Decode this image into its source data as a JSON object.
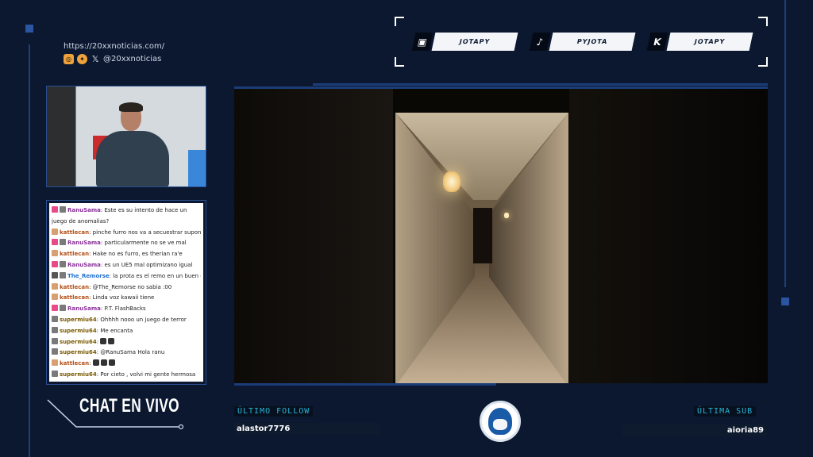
{
  "social": {
    "url": "https://20xxnoticias.com/",
    "handle": "@20xxnoticias",
    "icons": [
      "instagram-icon",
      "bluesky-icon",
      "x-icon"
    ]
  },
  "platforms": [
    {
      "icon": "twitch-icon",
      "label": "JOTAPY"
    },
    {
      "icon": "tiktok-icon",
      "label": "PYJOTA"
    },
    {
      "icon": "kick-icon",
      "label": "JOTAPY"
    }
  ],
  "chat": {
    "title": "CHAT EN VIVO",
    "messages": [
      {
        "user": "RanuSama",
        "text": "Este es su intento de hace un juego de anomalias?"
      },
      {
        "user": "kattlecan",
        "text": "pinche furro nos va a secuestrar supongo"
      },
      {
        "user": "RanuSama",
        "text": "particularmente no se ve mal"
      },
      {
        "user": "kattlecan",
        "text": "Hake no es furro, es therian ra'e"
      },
      {
        "user": "RanuSama",
        "text": "es un UE5 mal optimizano igual"
      },
      {
        "user": "The_Remorse",
        "text": "la prota es el remo en un buen dia"
      },
      {
        "user": "kattlecan",
        "text": "@The_Remorse no sabia :00"
      },
      {
        "user": "kattlecan",
        "text": "Linda voz kawaii tiene"
      },
      {
        "user": "RanuSama",
        "text": "P.T. FlashBacks"
      },
      {
        "user": "supermiu64",
        "text": "Ohhhh nooo un juego de terror"
      },
      {
        "user": "supermiu64",
        "text": "Me encanta"
      },
      {
        "user": "supermiu64",
        "text": ""
      },
      {
        "user": "supermiu64",
        "text": "@RanuSama Hola ranu"
      },
      {
        "user": "kattlecan",
        "text": ""
      },
      {
        "user": "supermiu64",
        "text": "Por cieto , volvi mi gente hermosa"
      }
    ]
  },
  "bottom": {
    "follow_label": "ÚLTIMO FOLLOW",
    "follow_name": "alastor7776",
    "sub_label": "ÚLTIMA SUB",
    "sub_name": "aioria89"
  }
}
